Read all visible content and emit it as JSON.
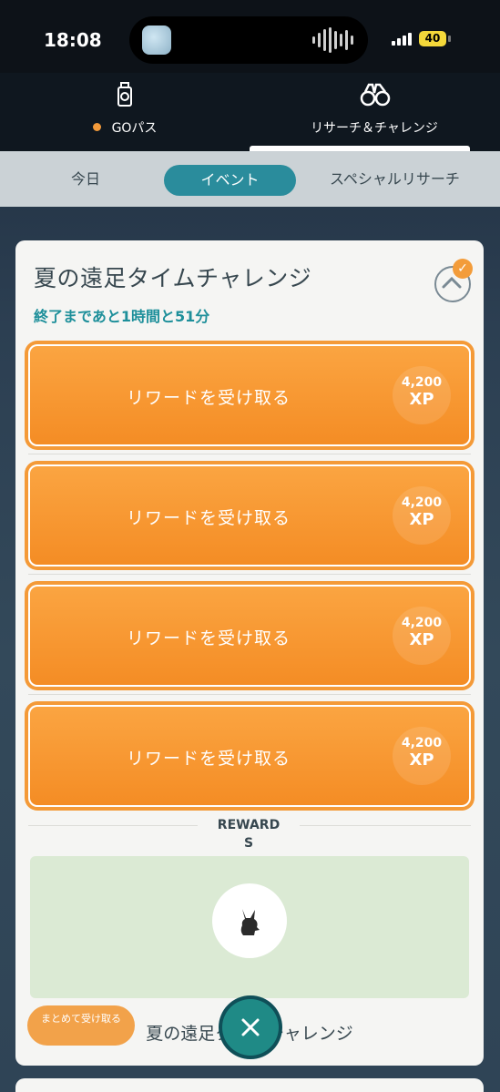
{
  "status": {
    "time": "18:08",
    "battery": "40"
  },
  "topnav": {
    "tabs": [
      {
        "label": "GOパス",
        "icon": "go-pass-icon",
        "active": false,
        "dot_color": "#f29a3a"
      },
      {
        "label": "リサーチ＆チャレンジ",
        "icon": "binoculars-icon",
        "active": true
      }
    ]
  },
  "subtabs": {
    "items": [
      "今日",
      "イベント",
      "スペシャルリサーチ"
    ],
    "active": "イベント"
  },
  "challenge": {
    "title": "夏の遠足タイムチャレンジ",
    "remaining": "終了まであと1時間と51分",
    "rows": [
      {
        "label": "リワードを受け取る",
        "xp_amount": "4,200",
        "xp_unit": "XP"
      },
      {
        "label": "リワードを受け取る",
        "xp_amount": "4,200",
        "xp_unit": "XP"
      },
      {
        "label": "リワードを受け取る",
        "xp_amount": "4,200",
        "xp_unit": "XP"
      },
      {
        "label": "リワードを受け取る",
        "xp_amount": "4,200",
        "xp_unit": "XP"
      }
    ],
    "rewards_heading_line1": "REWARD",
    "rewards_heading_line2": "S",
    "reward_icon": "pikachu-silhouette-icon",
    "footer_title": "夏の遠足タイムチャレンジ"
  },
  "actions": {
    "claim_all": "まとめて受け取る"
  },
  "colors": {
    "accent_orange": "#f48c24",
    "teal": "#2a8c9c",
    "text_teal": "#1d8f9a",
    "reward_bg": "#dbead4"
  }
}
